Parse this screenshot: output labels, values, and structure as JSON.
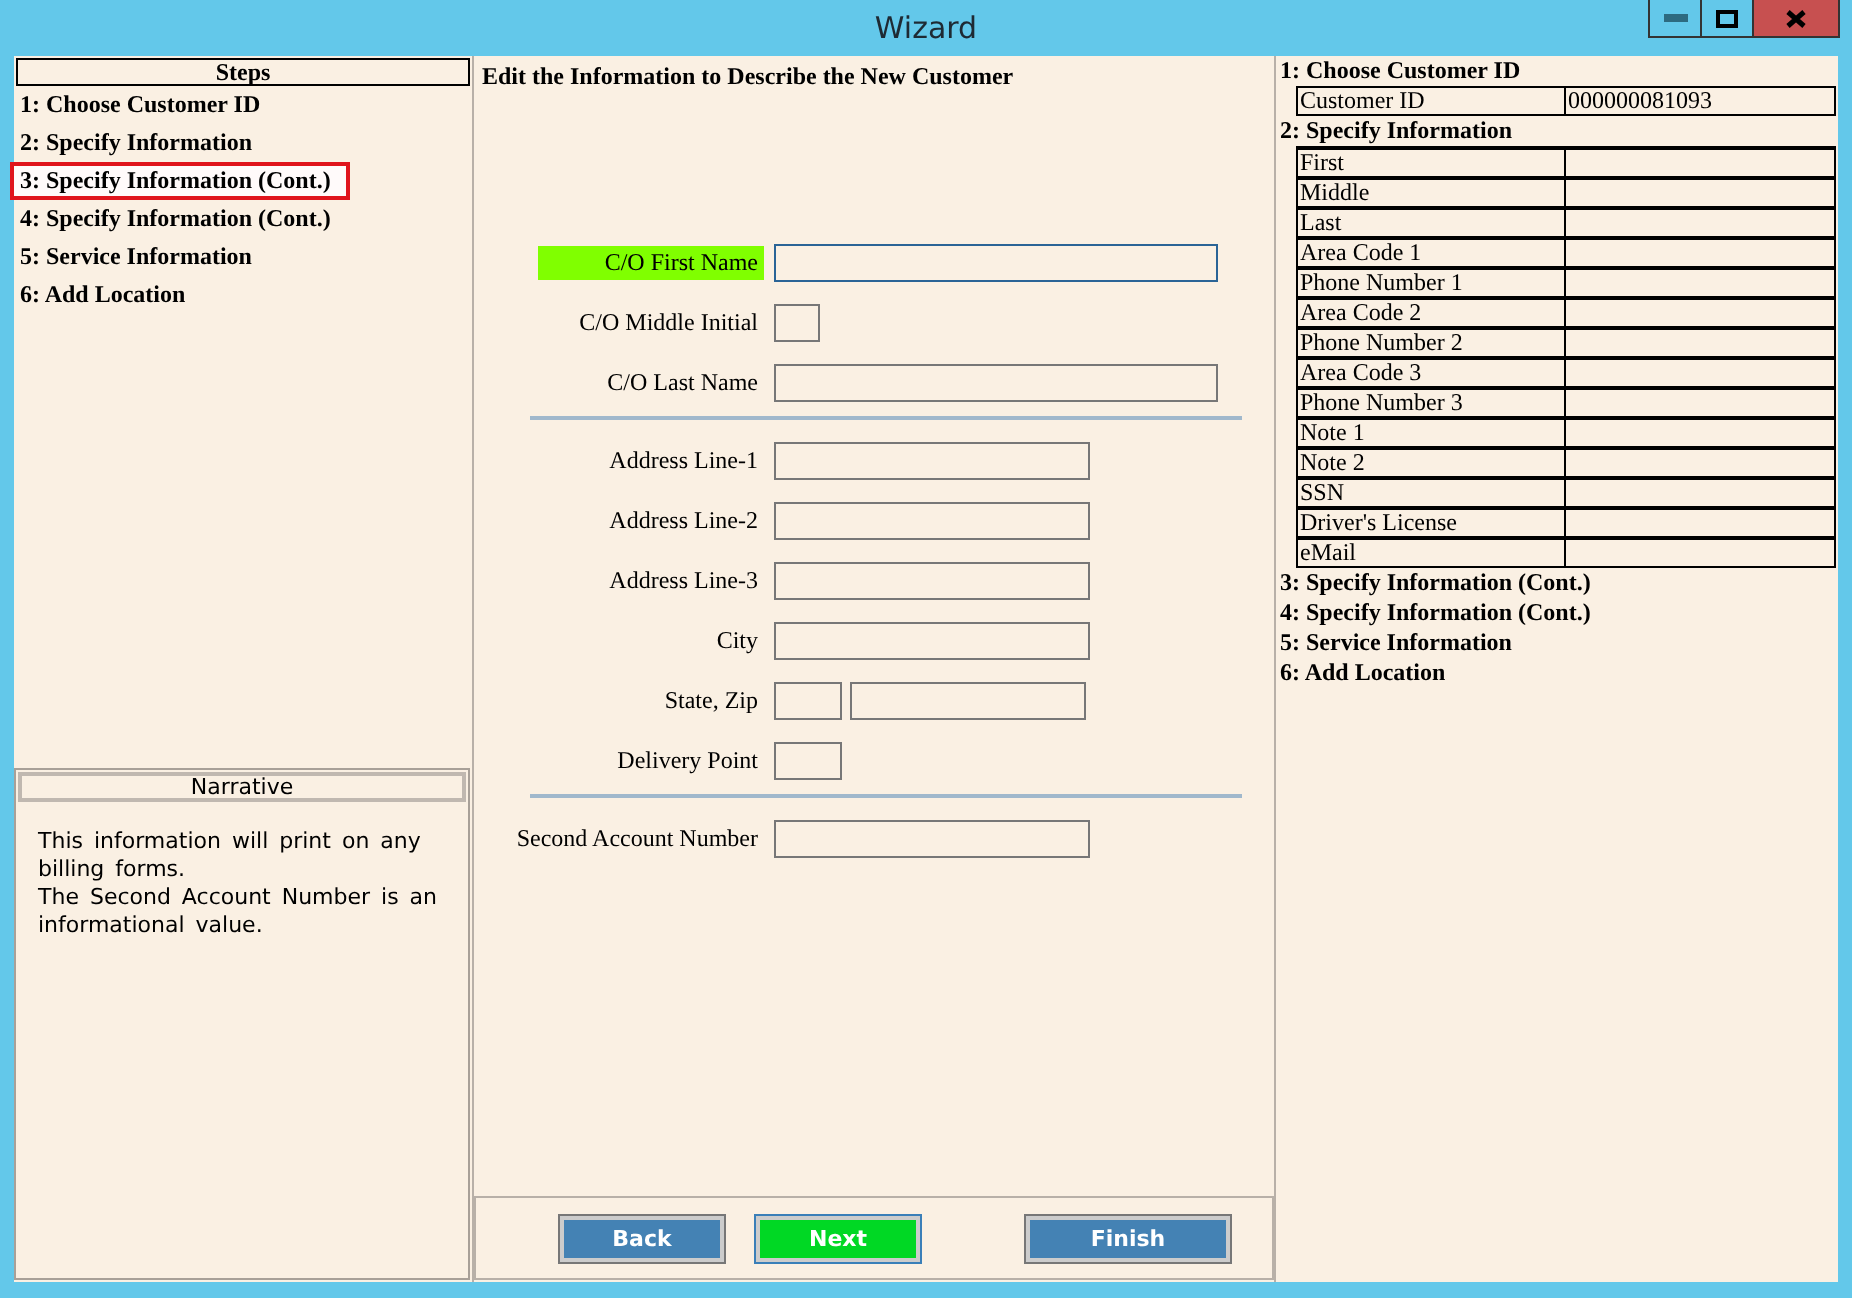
{
  "window": {
    "title": "Wizard"
  },
  "steps": {
    "title": "Steps",
    "items": [
      {
        "label": "1: Choose Customer ID",
        "selected": false
      },
      {
        "label": "2: Specify Information",
        "selected": false
      },
      {
        "label": "3: Specify Information (Cont.)",
        "selected": true
      },
      {
        "label": "4: Specify Information (Cont.)",
        "selected": false
      },
      {
        "label": "5: Service Information",
        "selected": false
      },
      {
        "label": "6: Add Location",
        "selected": false
      }
    ]
  },
  "narrative": {
    "title": "Narrative",
    "text": "This information will print on any billing forms.\nThe Second Account Number is an informational value."
  },
  "form": {
    "heading": "Edit the Information to Describe the New Customer",
    "rows": [
      {
        "kind": "field",
        "label": "C/O First Name",
        "focused": true,
        "inputs": [
          {
            "kind": "wide"
          }
        ]
      },
      {
        "kind": "field",
        "label": "C/O Middle Initial",
        "focused": false,
        "inputs": [
          {
            "kind": "tiny"
          }
        ]
      },
      {
        "kind": "field",
        "label": "C/O Last Name",
        "focused": false,
        "inputs": [
          {
            "kind": "wide"
          }
        ]
      },
      {
        "kind": "divider"
      },
      {
        "kind": "field",
        "label": "Address Line-1",
        "focused": false,
        "inputs": [
          {
            "kind": "medium"
          }
        ]
      },
      {
        "kind": "field",
        "label": "Address Line-2",
        "focused": false,
        "inputs": [
          {
            "kind": "medium"
          }
        ]
      },
      {
        "kind": "field",
        "label": "Address Line-3",
        "focused": false,
        "inputs": [
          {
            "kind": "medium"
          }
        ]
      },
      {
        "kind": "field",
        "label": "City",
        "focused": false,
        "inputs": [
          {
            "kind": "medium"
          }
        ]
      },
      {
        "kind": "field",
        "label": "State, Zip",
        "focused": false,
        "inputs": [
          {
            "kind": "small"
          },
          {
            "kind": "zip"
          }
        ]
      },
      {
        "kind": "field",
        "label": "Delivery Point",
        "focused": false,
        "inputs": [
          {
            "kind": "small"
          }
        ]
      },
      {
        "kind": "divider"
      },
      {
        "kind": "field",
        "label": "Second Account Number",
        "focused": false,
        "inputs": [
          {
            "kind": "medium"
          }
        ]
      }
    ]
  },
  "buttons": [
    {
      "label": "Back",
      "kind": "normal"
    },
    {
      "label": "Next",
      "kind": "primary"
    },
    {
      "label": "Finish",
      "kind": "normal"
    }
  ],
  "summary": [
    {
      "title": "1: Choose Customer ID",
      "rows": [
        {
          "label": "Customer  ID",
          "value": "000000081093"
        }
      ]
    },
    {
      "title": "2: Specify Information",
      "rows": [
        {
          "label": "First"
        },
        {
          "label": "Middle"
        },
        {
          "label": "Last"
        },
        {
          "label": "Area Code 1"
        },
        {
          "label": "Phone Number 1"
        },
        {
          "label": "Area Code 2"
        },
        {
          "label": "Phone Number 2"
        },
        {
          "label": "Area Code 3"
        },
        {
          "label": "Phone Number 3"
        },
        {
          "label": "Note 1"
        },
        {
          "label": "Note 2"
        },
        {
          "label": "SSN"
        },
        {
          "label": "Driver's License"
        },
        {
          "label": "eMail"
        }
      ]
    },
    {
      "title": "3: Specify Information (Cont.)"
    },
    {
      "title": "4: Specify Information (Cont.)"
    },
    {
      "title": "5: Service Information"
    },
    {
      "title": "6: Add Location"
    }
  ]
}
